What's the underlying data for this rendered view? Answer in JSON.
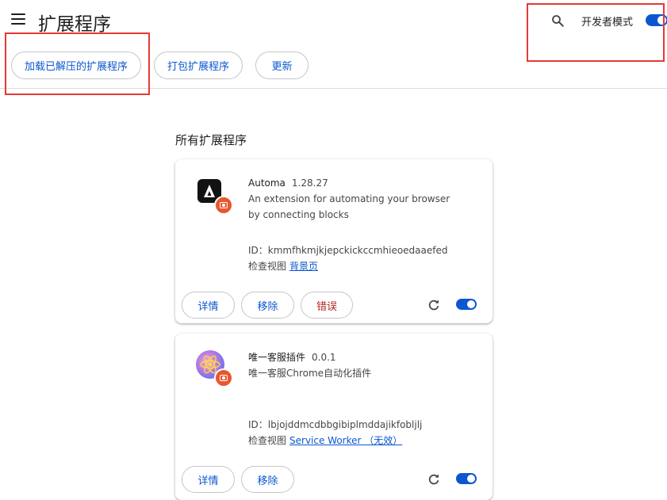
{
  "header": {
    "title": "扩展程序",
    "developer_mode_label": "开发者模式",
    "developer_mode_on": true
  },
  "toolbar": {
    "load_unpacked": "加载已解压的扩展程序",
    "pack": "打包扩展程序",
    "update": "更新"
  },
  "section": {
    "heading": "所有扩展程序"
  },
  "extensions": [
    {
      "name": "Automa",
      "version": "1.28.27",
      "description": "An extension for automating your browser by connecting blocks",
      "id_text": "ID：kmmfhkmjkjepckickccmhieoedaaefed",
      "inspect_label": "检查视图",
      "inspect_link": "背景页",
      "details_label": "详情",
      "remove_label": "移除",
      "errors_label": "错误",
      "enabled": true
    },
    {
      "name": "唯一客服插件",
      "version": "0.0.1",
      "description": "唯一客服Chrome自动化插件",
      "id_text": "ID：lbjojddmcdbbgibiplmddajikfobljlj",
      "inspect_label": "检查视图",
      "inspect_link": "Service Worker （无效）",
      "details_label": "详情",
      "remove_label": "移除",
      "enabled": true
    }
  ],
  "colors": {
    "accent": "#0b57d0",
    "error": "#b3261e",
    "annotation": "#e53935"
  }
}
